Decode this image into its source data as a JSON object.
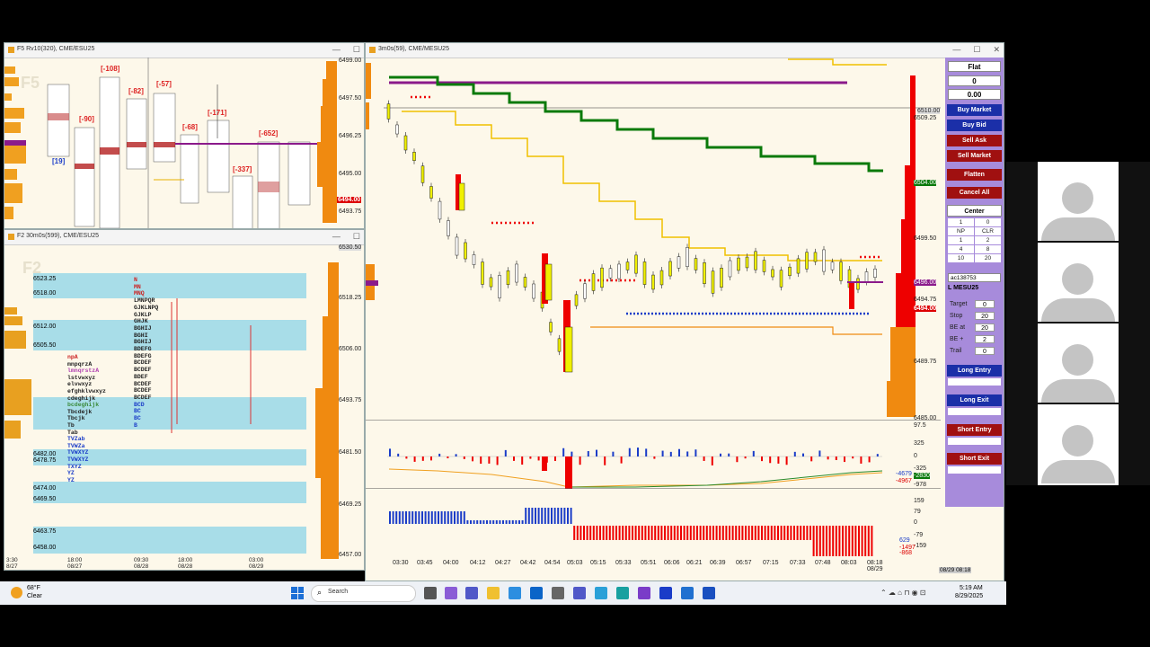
{
  "top_left_window": {
    "title": "F5 Rv10(320), CME/ESU25",
    "watermark": "F5",
    "price_labels": [
      "6499.00",
      "6497.50",
      "6496.25",
      "6495.00",
      "6494.00",
      "6493.75"
    ],
    "current_price": "6494.00",
    "deltas": [
      "[19]",
      "[-90]",
      "[-108]",
      "[-82]",
      "[-57]",
      "[-68]",
      "[-171]",
      "[-337]",
      "[-652]"
    ]
  },
  "bottom_left_window": {
    "title": "F2 30m0s(599), CME/ESU25",
    "watermark": "F2",
    "left_prices": [
      "6523.25",
      "6518.00",
      "6512.00",
      "6505.50",
      "6482.00",
      "6478.75",
      "6474.00",
      "6469.50",
      "6463.75",
      "6458.00"
    ],
    "axis_prices": [
      "6530.50",
      "6518.25",
      "6506.00",
      "6493.75",
      "6481.50",
      "6469.25",
      "6457.00"
    ],
    "time_labels": [
      "3:30\n8/27",
      "18:00\n08/27",
      "09:30\n08/28",
      "18:00\n08/28",
      "03:00\n08/29"
    ],
    "profile_rows": [
      "N",
      "MN",
      "MNQ",
      "LMNPQR",
      "GJKLNPQ",
      "GJKLP",
      "GHJK",
      "BGHIJ",
      "BGHI",
      "BGHIJ",
      "BDEFG",
      "BDEFG",
      "BCDEF",
      "BCDEF",
      "BDEF",
      "BCDEF",
      "BCDEF",
      "BCDEF",
      "BCD",
      "BC",
      "BC",
      "B"
    ],
    "left_rows": [
      "npA",
      "mnpqrzA",
      "lmnqrstzA",
      "lstvwxyz",
      "elvwxyz",
      "efghklvwxyz",
      "cdeghijk",
      "bcdeghijk",
      "Tbcdejk",
      "Tbcjk",
      "Tb",
      "Tab",
      "TVZab",
      "TVWZa",
      "TVWXYZ",
      "TVWXYZ",
      "TXYZ",
      "YZ",
      "YZ"
    ]
  },
  "main_chart_window": {
    "title": "3m0s(59), CME/MESU25",
    "price_labels": [
      "6509.25",
      "6504.00",
      "6499.50",
      "6496.00",
      "6494.75",
      "6494.00",
      "6489.75",
      "6485.00"
    ],
    "current_price": "6494.00",
    "green_tag": "6504.00",
    "purple_tag": "6496.00",
    "top_tag": "6510.00",
    "indicator1_labels": [
      "97.5",
      "325",
      "0",
      "-325",
      "-978"
    ],
    "indicator1_values": [
      "-4679",
      "-2830",
      "-4967"
    ],
    "indicator2_labels": [
      "159",
      "79",
      "0",
      "-79",
      "-159"
    ],
    "indicator2_values": [
      "629",
      "-1497",
      "-868"
    ],
    "time_labels": [
      "03:30",
      "03:45",
      "04:00",
      "04:12",
      "04:27",
      "04:42",
      "04:54",
      "05:03",
      "05:15",
      "05:33",
      "05:51",
      "06:06",
      "06:21",
      "06:39",
      "06:57",
      "07:15",
      "07:33",
      "07:48",
      "08:03",
      "08:18\n08/29"
    ],
    "corner_date": "08/29 08:18"
  },
  "order_panel": {
    "position": "Flat",
    "qty": "0",
    "pnl": "0.00",
    "buttons": [
      "Buy Market",
      "Buy Bid",
      "Sell Ask",
      "Sell Market",
      "Flatten",
      "Cancel All",
      "Center"
    ],
    "qty_grid": [
      "1",
      "0",
      "NP",
      "CLR",
      "1",
      "2",
      "4",
      "8",
      "10",
      "20"
    ],
    "account": "ac138753",
    "instrument": "L MESU25",
    "target_label": "Target",
    "target_val": "0",
    "stop_label": "Stop",
    "stop_val": "20",
    "beat_label": "BE at",
    "beat_val": "20",
    "beplus_label": "BE +",
    "beplus_val": "2",
    "trail_label": "Trail",
    "trail_val": "0",
    "long_entry": "Long Entry",
    "long_exit": "Long Exit",
    "short_entry": "Short Entry",
    "short_exit": "Short Exit"
  },
  "taskbar": {
    "weather_temp": "68°F",
    "weather_desc": "Clear",
    "search_placeholder": "Search",
    "time": "5:19 AM",
    "date": "8/29/2025"
  }
}
